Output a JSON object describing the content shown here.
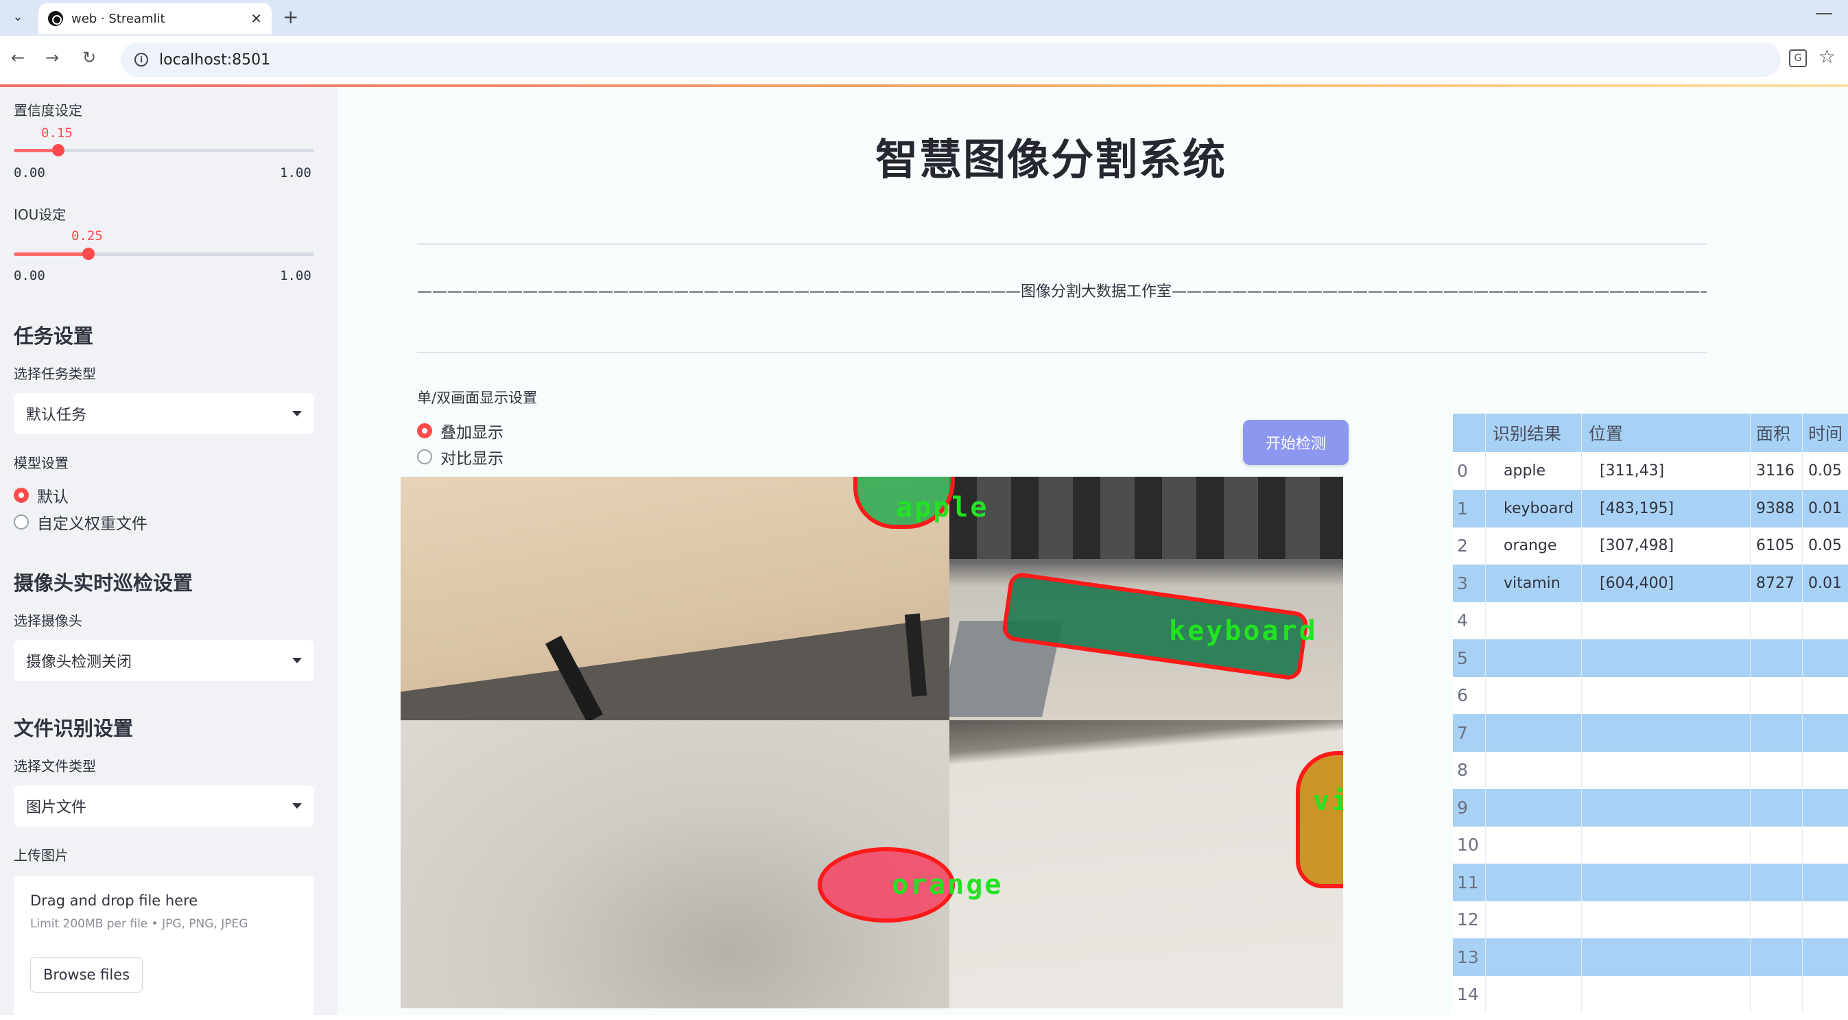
{
  "browser": {
    "tab_title": "web · Streamlit",
    "url": "localhost:8501"
  },
  "sidebar": {
    "confidence": {
      "label": "置信度设定",
      "value": "0.15",
      "min": "0.00",
      "max": "1.00",
      "fraction": 0.15
    },
    "iou": {
      "label": "IOU设定",
      "value": "0.25",
      "min": "0.00",
      "max": "1.00",
      "fraction": 0.25
    },
    "task_header": "任务设置",
    "task_type_label": "选择任务类型",
    "task_type_value": "默认任务",
    "model_label": "模型设置",
    "model_options": [
      "默认",
      "自定义权重文件"
    ],
    "camera_header": "摄像头实时巡检设置",
    "camera_label": "选择摄像头",
    "camera_value": "摄像头检测关闭",
    "file_header": "文件识别设置",
    "file_type_label": "选择文件类型",
    "file_type_value": "图片文件",
    "upload_label": "上传图片",
    "dropzone_title": "Drag and drop file here",
    "dropzone_sub": "Limit 200MB per file • JPG, PNG, JPEG",
    "browse_label": "Browse files"
  },
  "main": {
    "title": "智慧图像分割系统",
    "studio_line": "————————————————————————————————————————图像分割大数据工作室————————————————————————————————————————",
    "display_label": "单/双画面显示设置",
    "display_options": [
      "叠加显示",
      "对比显示"
    ],
    "detect_button": "开始检测",
    "detections": [
      "apple",
      "keyboard",
      "orange",
      "vit"
    ]
  },
  "table": {
    "headers": [
      "识别结果",
      "位置",
      "面积",
      "时间"
    ],
    "rows": [
      {
        "idx": "0",
        "name": "apple",
        "pos": "[311,43]",
        "area": "3116",
        "time": "0.05"
      },
      {
        "idx": "1",
        "name": "keyboard",
        "pos": "[483,195]",
        "area": "9388",
        "time": "0.01"
      },
      {
        "idx": "2",
        "name": "orange",
        "pos": "[307,498]",
        "area": "6105",
        "time": "0.05"
      },
      {
        "idx": "3",
        "name": "vitamin",
        "pos": "[604,400]",
        "area": "8727",
        "time": "0.01"
      },
      {
        "idx": "4",
        "name": "",
        "pos": "",
        "area": "",
        "time": ""
      },
      {
        "idx": "5",
        "name": "",
        "pos": "",
        "area": "",
        "time": ""
      },
      {
        "idx": "6",
        "name": "",
        "pos": "",
        "area": "",
        "time": ""
      },
      {
        "idx": "7",
        "name": "",
        "pos": "",
        "area": "",
        "time": ""
      },
      {
        "idx": "8",
        "name": "",
        "pos": "",
        "area": "",
        "time": ""
      },
      {
        "idx": "9",
        "name": "",
        "pos": "",
        "area": "",
        "time": ""
      },
      {
        "idx": "10",
        "name": "",
        "pos": "",
        "area": "",
        "time": ""
      },
      {
        "idx": "11",
        "name": "",
        "pos": "",
        "area": "",
        "time": ""
      },
      {
        "idx": "12",
        "name": "",
        "pos": "",
        "area": "",
        "time": ""
      },
      {
        "idx": "13",
        "name": "",
        "pos": "",
        "area": "",
        "time": ""
      },
      {
        "idx": "14",
        "name": "",
        "pos": "",
        "area": "",
        "time": ""
      }
    ]
  },
  "colors": {
    "accent": "#ff4b4b",
    "button": "#8c97f0",
    "table_stripe": "#a8d2f5",
    "sidebar_bg": "#f0f2f6",
    "seg_outline": "#ff1a1a",
    "seg_label": "#22e322"
  }
}
